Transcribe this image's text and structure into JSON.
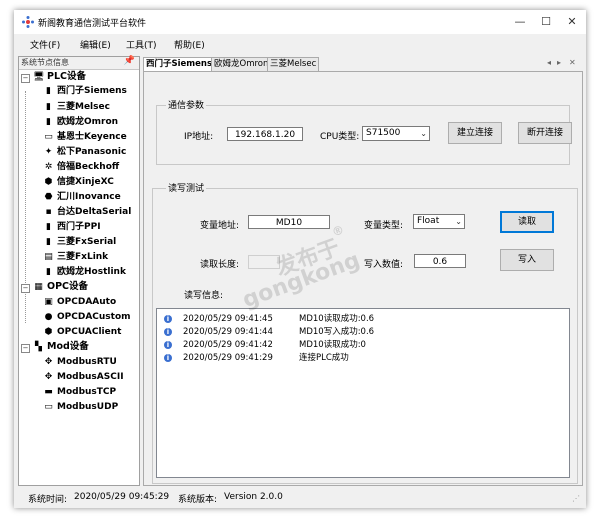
{
  "window": {
    "title": "新阁教育通信测试平台软件",
    "controls": {
      "minimize": "—",
      "maximize": "☐",
      "close": "✕"
    }
  },
  "menu": [
    {
      "label": "文件(F)"
    },
    {
      "label": "编辑(E)"
    },
    {
      "label": "工具(T)"
    },
    {
      "label": "帮助(E)"
    }
  ],
  "tree": {
    "header": "系统节点信息",
    "groups": [
      {
        "label": "PLC设备",
        "icon": "monitor-icon",
        "items": [
          {
            "label": "西门子Siemens",
            "icon": "plc-icon"
          },
          {
            "label": "三菱Melsec",
            "icon": "plc-icon"
          },
          {
            "label": "欧姆龙Omron",
            "icon": "plc-icon"
          },
          {
            "label": "基恩士Keyence",
            "icon": "plc-icon"
          },
          {
            "label": "松下Panasonic",
            "icon": "plc-icon"
          },
          {
            "label": "倍福Beckhoff",
            "icon": "plc-icon"
          },
          {
            "label": "信捷XinjeXC",
            "icon": "plc-icon"
          },
          {
            "label": "汇川Inovance",
            "icon": "plc-icon"
          },
          {
            "label": "台达DeltaSerial",
            "icon": "plc-icon"
          },
          {
            "label": "西门子PPI",
            "icon": "plc-icon"
          },
          {
            "label": "三菱FxSerial",
            "icon": "plc-icon"
          },
          {
            "label": "三菱FxLink",
            "icon": "plc-icon"
          },
          {
            "label": "欧姆龙Hostlink",
            "icon": "plc-icon"
          }
        ]
      },
      {
        "label": "OPC设备",
        "icon": "server-icon",
        "items": [
          {
            "label": "OPCDAAuto",
            "icon": "opc-icon"
          },
          {
            "label": "OPCDACustom",
            "icon": "opc-icon"
          },
          {
            "label": "OPCUAClient",
            "icon": "opc-icon"
          }
        ]
      },
      {
        "label": "Mod设备",
        "icon": "network-icon",
        "items": [
          {
            "label": "ModbusRTU",
            "icon": "modbus-icon"
          },
          {
            "label": "ModbusASCII",
            "icon": "modbus-icon"
          },
          {
            "label": "ModbusTCP",
            "icon": "modbus-icon"
          },
          {
            "label": "ModbusUDP",
            "icon": "modbus-icon"
          }
        ]
      }
    ]
  },
  "tabs": [
    {
      "label": "西门子Siemens",
      "active": true
    },
    {
      "label": "欧姆龙Omron",
      "active": false
    },
    {
      "label": "三菱Melsec",
      "active": false
    }
  ],
  "comm": {
    "title": "通信参数",
    "ip_label": "IP地址:",
    "ip_value": "192.168.1.20",
    "cpu_label": "CPU类型:",
    "cpu_value": "S71500",
    "connect_button": "建立连接",
    "disconnect_button": "断开连接"
  },
  "rw": {
    "title": "读写测试",
    "addr_label": "变量地址:",
    "addr_value": "MD10",
    "type_label": "变量类型:",
    "type_value": "Float",
    "read_button": "读取",
    "len_label": "读取长度:",
    "len_value": "",
    "write_label": "写入数值:",
    "write_value": "0.6",
    "write_button": "写入",
    "log_label": "读写信息:",
    "log": [
      {
        "time": "2020/05/29 09:41:45",
        "msg": "MD10读取成功:0.6"
      },
      {
        "time": "2020/05/29 09:41:44",
        "msg": "MD10写入成功:0.6"
      },
      {
        "time": "2020/05/29 09:41:42",
        "msg": "MD10读取成功:0"
      },
      {
        "time": "2020/05/29 09:41:29",
        "msg": "连接PLC成功"
      }
    ]
  },
  "status": {
    "time_label": "系统时间:",
    "time_value": "2020/05/29 09:45:29",
    "version_label": "系统版本:",
    "version_value": "Version 2.0.0"
  },
  "watermark": {
    "line1": "发布于",
    "line2": "gongkong",
    "mark": "®"
  },
  "colors": {
    "accent": "#0078d7",
    "info": "#3a6fd0"
  }
}
